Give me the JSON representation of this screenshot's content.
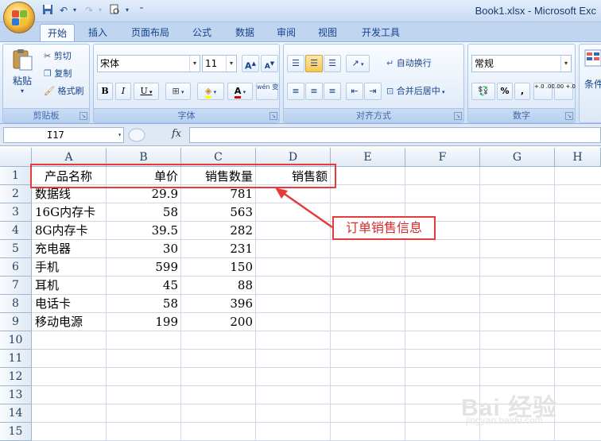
{
  "window": {
    "title": "Book1.xlsx - Microsoft Exc"
  },
  "tabs": [
    {
      "label": "开始",
      "active": true
    },
    {
      "label": "插入"
    },
    {
      "label": "页面布局"
    },
    {
      "label": "公式"
    },
    {
      "label": "数据"
    },
    {
      "label": "审阅"
    },
    {
      "label": "视图"
    },
    {
      "label": "开发工具"
    }
  ],
  "ribbon": {
    "clipboard": {
      "label": "剪贴板",
      "paste": "粘贴",
      "cut": "剪切",
      "copy": "复制",
      "format_painter": "格式刷"
    },
    "font": {
      "label": "字体",
      "family": "宋体",
      "size": "11",
      "grow": "A",
      "shrink": "A",
      "bold": "B",
      "italic": "I",
      "underline": "U",
      "font_color_letter": "A",
      "phonetic": "wén 变"
    },
    "alignment": {
      "label": "对齐方式",
      "wrap_text": "自动换行",
      "merge_center": "合并后居中"
    },
    "number": {
      "label": "数字",
      "format": "常规",
      "percent": "%",
      "comma": ",",
      "inc_decimal": "+.0 .00",
      "dec_decimal": ".00 +.0"
    },
    "styles": {
      "conditional_partial": "条件"
    }
  },
  "formula_bar": {
    "name_box": "I17",
    "fx": "fx",
    "formula": ""
  },
  "sheet": {
    "columns": [
      "A",
      "B",
      "C",
      "D",
      "E",
      "F",
      "G",
      "H"
    ],
    "rows": [
      "1",
      "2",
      "3",
      "4",
      "5",
      "6",
      "7",
      "8",
      "9",
      "10",
      "11",
      "12",
      "13",
      "14",
      "15"
    ],
    "header": [
      "产品名称",
      "单价",
      "销售数量",
      "销售额"
    ],
    "data": [
      [
        "数据线",
        "29.9",
        "781"
      ],
      [
        "16G内存卡",
        "58",
        "563"
      ],
      [
        "8G内存卡",
        "39.5",
        "282"
      ],
      [
        "充电器",
        "30",
        "231"
      ],
      [
        "手机",
        "599",
        "150"
      ],
      [
        "耳机",
        "45",
        "88"
      ],
      [
        "电话卡",
        "58",
        "396"
      ],
      [
        "移动电源",
        "199",
        "200"
      ]
    ]
  },
  "annotation": {
    "callout": "订单销售信息",
    "color": "#e53b3b"
  },
  "watermark": {
    "brand": "Bai 经验",
    "url": "jingyan.baidu.com"
  }
}
